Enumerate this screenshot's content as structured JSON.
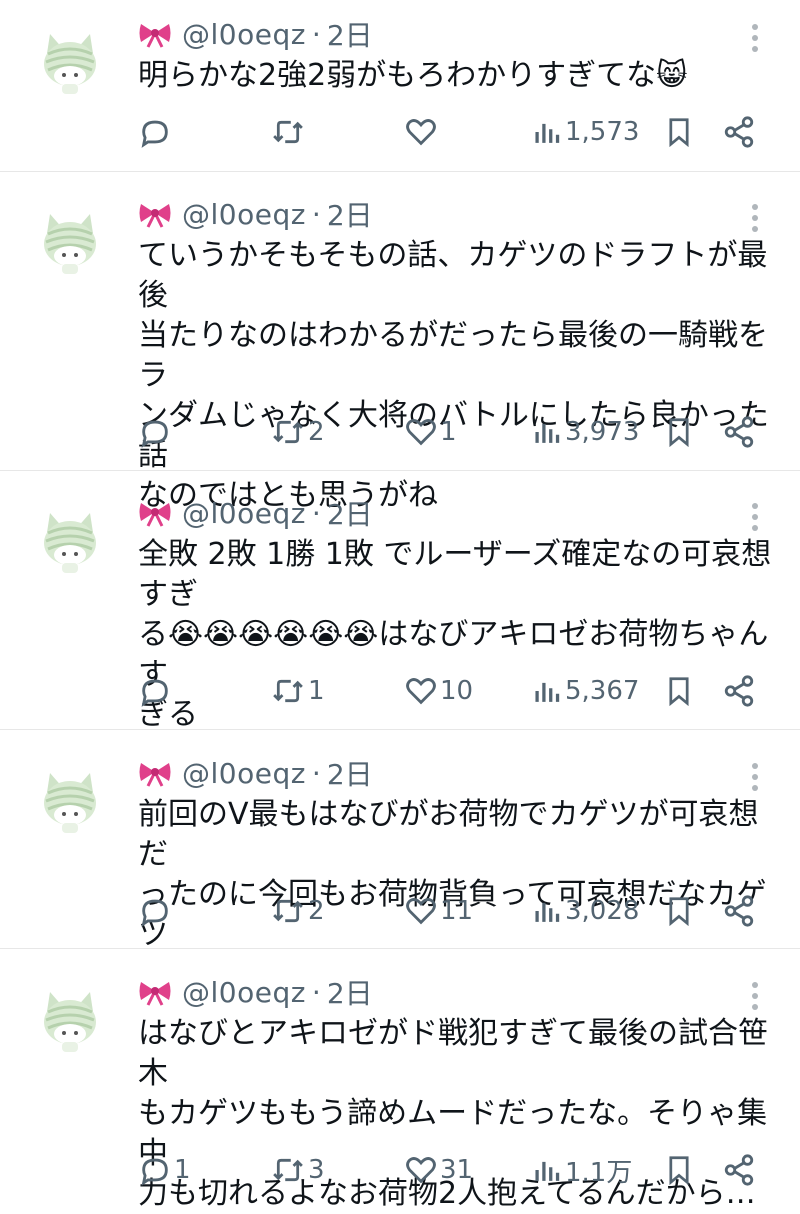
{
  "posts": [
    {
      "handle": "@l0oeqz",
      "sep": "·",
      "time": "2日",
      "text": "明らかな2強2弱がもろわかりすぎてな😸",
      "replies": "",
      "reposts": "",
      "likes": "",
      "views": "1,573"
    },
    {
      "handle": "@l0oeqz",
      "sep": "·",
      "time": "2日",
      "text": "ていうかそもそもの話、カゲツのドラフトが最後\n当たりなのはわかるがだったら最後の一騎戦をラ\nンダムじゃなく大将のバトルにしたら良かった話\nなのではとも思うがね",
      "replies": "",
      "reposts": "2",
      "likes": "1",
      "views": "3,973"
    },
    {
      "handle": "@l0oeqz",
      "sep": "·",
      "time": "2日",
      "text": "全敗 2敗 1勝 1敗 でルーザーズ確定なの可哀想すぎ\nる😭😭😭😭😭😭はなびアキロゼお荷物ちゃんす\nぎる",
      "replies": "",
      "reposts": "1",
      "likes": "10",
      "views": "5,367"
    },
    {
      "handle": "@l0oeqz",
      "sep": "·",
      "time": "2日",
      "text": "前回のV最もはなびがお荷物でカゲツが可哀想だ\nったのに今回もお荷物背負って可哀想だなカゲツ",
      "replies": "",
      "reposts": "2",
      "likes": "11",
      "views": "3,028"
    },
    {
      "handle": "@l0oeqz",
      "sep": "·",
      "time": "2日",
      "text": "はなびとアキロゼがド戦犯すぎて最後の試合笹木\nもカゲツももう諦めムードだったな。そりゃ集中\n力も切れるよなお荷物2人抱えてるんだから…",
      "replies": "1",
      "reposts": "3",
      "likes": "31",
      "views": "1.1万"
    }
  ],
  "icons": {
    "avatar": "green-striped-cat-hat-avatar-icon",
    "bow": "pink-ribbon-bow-icon",
    "more": "vertical-dots-more-icon",
    "reply": "speech-bubble-reply-icon",
    "repost": "repost-arrows-icon",
    "like": "heart-like-icon",
    "views": "bar-chart-views-icon",
    "bookmark": "bookmark-icon",
    "share": "share-nodes-icon"
  },
  "colors": {
    "text": "#0f1419",
    "secondary": "#536471",
    "divider": "#e7e7e7",
    "bow": "#e0408a",
    "avatar": "#cfe3c8"
  }
}
